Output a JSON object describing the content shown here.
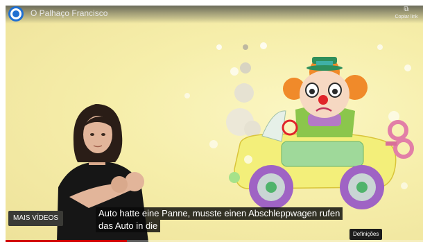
{
  "player": {
    "title": "O Palhaço Francisco",
    "copy_link_icon": "copy-icon",
    "copy_link_label": "Copiar link",
    "more_videos_label": "MAIS VÍDEOS",
    "settings_label": "Definições",
    "captions": [
      "Auto hatte eine Panne, musste einen Abschleppwagen rufen",
      "das Auto in die"
    ]
  },
  "colors": {
    "background": "#f6eeaa",
    "channel_logo": "#1f6fd1",
    "car_body": "#f3ef7a",
    "clown_hair": "#f08a2a",
    "progress": "#d10000"
  }
}
